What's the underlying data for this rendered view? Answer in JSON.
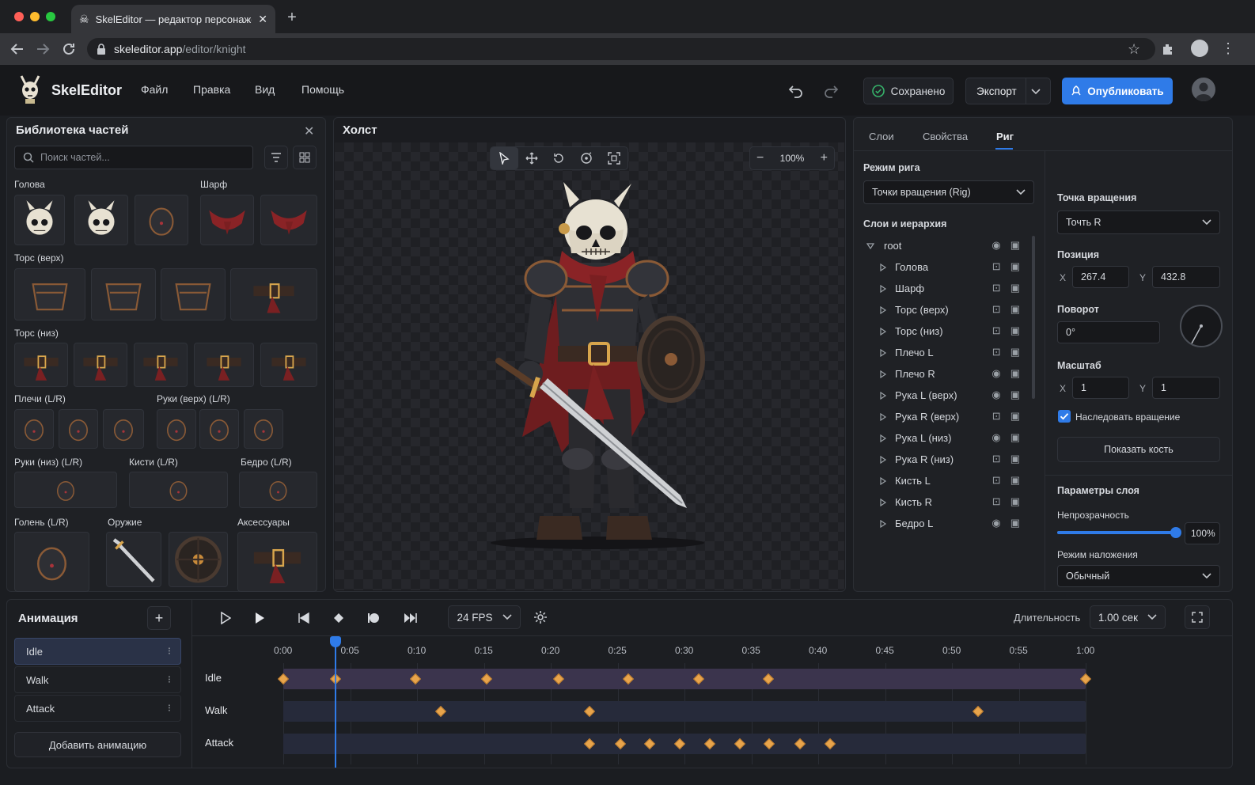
{
  "browser": {
    "tab_title": "SkelEditor — редактор персонажей",
    "url_host": "skeleditor.app",
    "url_path": "/editor/knight"
  },
  "app": {
    "name": "SkelEditor",
    "menu": [
      "Файл",
      "Правка",
      "Вид",
      "Помощь"
    ],
    "saved": "Сохранено",
    "export": "Экспорт",
    "publish": "Опубликовать"
  },
  "library": {
    "title": "Библиотека частей",
    "search_placeholder": "Поиск частей...",
    "sections": {
      "head": "Голова",
      "scarf": "Шарф",
      "torso_up": "Торс (верх)",
      "torso_low": "Торс (низ)",
      "shoulders": "Плечи (L/R)",
      "arms_up": "Руки (верх) (L/R)",
      "arms_low": "Руки (низ) (L/R)",
      "hands": "Кисти (L/R)",
      "thigh": "Бедро (L/R)",
      "shin": "Голень (L/R)",
      "weapon": "Оружие",
      "acc": "Аксессуары"
    }
  },
  "canvas": {
    "title": "Холст",
    "zoom": "100%"
  },
  "right": {
    "tabs": [
      "Слои",
      "Свойства",
      "Риг"
    ],
    "active_tab": "Риг",
    "rig_mode_label": "Режим рига",
    "rig_mode": "Точки вращения (Rig)",
    "hierarchy_label": "Слои и иерархия",
    "root": "root",
    "layers": [
      "Голова",
      "Шарф",
      "Торс (верх)",
      "Торс (низ)",
      "Плечо L",
      "Плечо R",
      "Рука L (верх)",
      "Рука R (верх)",
      "Рука L (низ)",
      "Рука R (низ)",
      "Кисть L",
      "Кисть R",
      "Бедро L"
    ],
    "pivot_label": "Точка вращения",
    "pivot": "Точть R",
    "position_label": "Позиция",
    "pos_x": "267.4",
    "pos_y": "432.8",
    "x": "X",
    "y": "Y",
    "rotation_label": "Поворот",
    "rotation": "0°",
    "scale_label": "Масштаб",
    "scale_x": "1",
    "scale_y": "1",
    "inherit": "Наследовать вращение",
    "inherit_checked": true,
    "show_bone": "Показать кость",
    "layer_params": "Параметры слоя",
    "opacity_label": "Непрозрачность",
    "opacity": "100%",
    "opacity_value": 1.0,
    "blend_label": "Режим наложения",
    "blend": "Обычный"
  },
  "animation": {
    "title": "Анимация",
    "items": [
      "Idle",
      "Walk",
      "Attack"
    ],
    "active": "Idle",
    "add": "Добавить анимацию",
    "fps": "24 FPS",
    "duration_label": "Длительность",
    "duration": "1.00 сек",
    "ticks": [
      "0:00",
      "0:05",
      "0:10",
      "0:15",
      "0:20",
      "0:25",
      "0:30",
      "0:35",
      "0:40",
      "0:45",
      "0:50",
      "0:55",
      "1:00"
    ],
    "tracks": [
      {
        "name": "Idle",
        "keys": [
          0,
          0.065,
          0.165,
          0.253,
          0.343,
          0.43,
          0.518,
          0.605,
          1.0
        ]
      },
      {
        "name": "Walk",
        "keys": [
          0.196,
          0.382,
          0.866
        ]
      },
      {
        "name": "Attack",
        "keys": [
          0.382,
          0.42,
          0.457,
          0.494,
          0.532,
          0.569,
          0.606,
          0.644,
          0.681
        ]
      }
    ],
    "playhead": 0.065
  },
  "colors": {
    "accent": "#2f7be8",
    "key": "#e8a44b",
    "bg": "#1b1d21"
  }
}
